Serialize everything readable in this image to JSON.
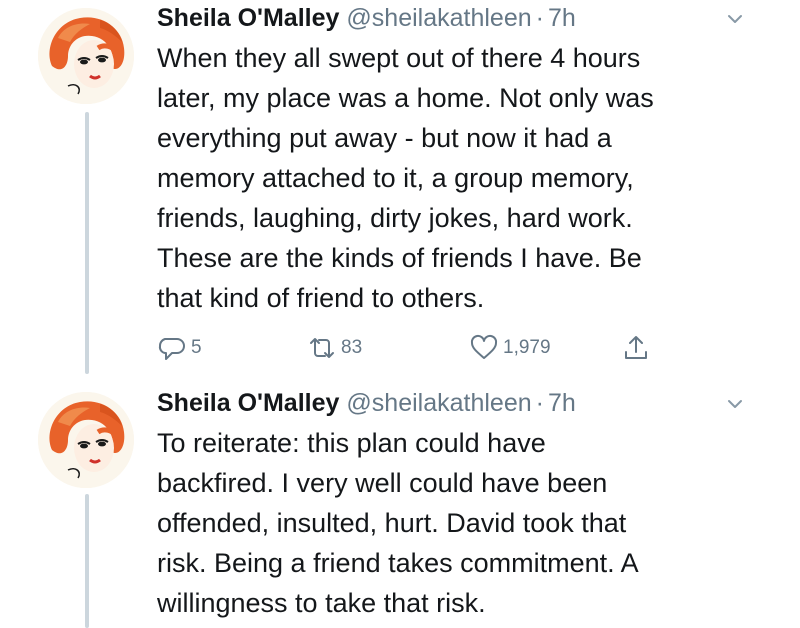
{
  "tweets": [
    {
      "name": "Sheila O'Malley",
      "handle": "@sheilakathleen",
      "separator": "·",
      "time": "7h",
      "text": "When they all swept out of there 4 hours\nlater, my place was a home. Not only was\neverything put away - but now it had a\nmemory attached to it, a group memory,\nfriends, laughing, dirty jokes, hard work.\nThese are the kinds of friends I have. Be\nthat kind of friend to others.",
      "replies": "5",
      "retweets": "83",
      "likes": "1,979"
    },
    {
      "name": "Sheila O'Malley",
      "handle": "@sheilakathleen",
      "separator": "·",
      "time": "7h",
      "text": "To reiterate: this plan could have\nbackfired. I very well could have been\noffended, insulted, hurt. David took that\nrisk. Being a friend takes commitment. A\nwillingness to take that risk."
    }
  ],
  "icons": {
    "reply": "speech-bubble",
    "retweet": "retweet-arrows",
    "like": "heart",
    "share": "share-upload-arrow",
    "caret": "chevron-down",
    "avatar": "red-haired-woman-illustration"
  },
  "colors": {
    "text": "#14171a",
    "muted": "#657786",
    "thread_line": "#ccd6dd",
    "avatar_hair": "#e8622a"
  }
}
